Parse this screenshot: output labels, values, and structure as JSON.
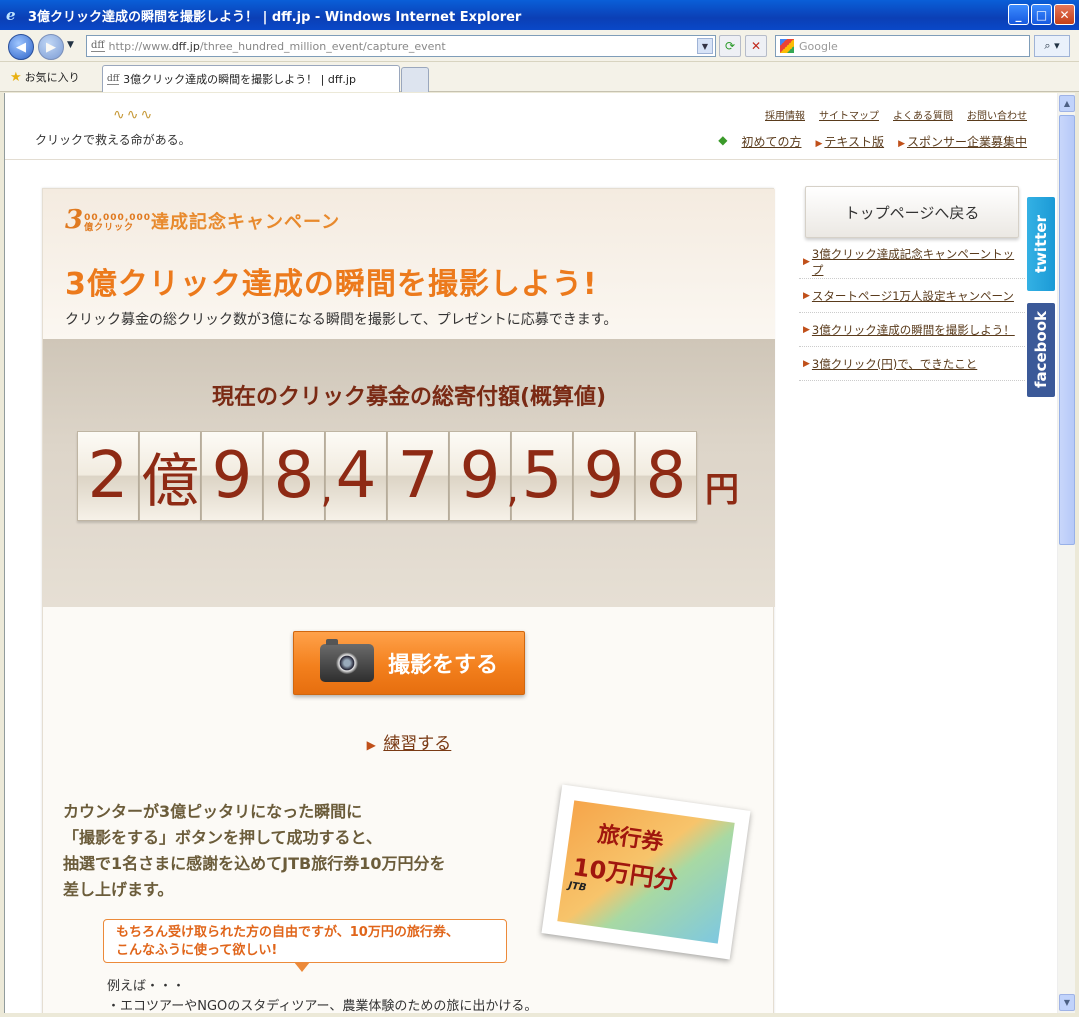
{
  "window": {
    "title": "3億クリック達成の瞬間を撮影しよう！ | dff.jp - Windows Internet Explorer",
    "minimize": "_",
    "maximize": "□",
    "close": "✕"
  },
  "address_bar": {
    "logo": "dff",
    "prefix": "http://www.",
    "host": "dff.jp",
    "path": "/three_hundred_million_event/capture_event"
  },
  "search": {
    "placeholder": "Google"
  },
  "favorites": {
    "label": "お気に入り"
  },
  "tab": {
    "logo": "dff",
    "title": "3億クリック達成の瞬間を撮影しよう！ | dff.jp"
  },
  "header": {
    "tagline": "クリックで救える命がある。",
    "top_links": [
      "採用情報",
      "サイトマップ",
      "よくある質問",
      "お問い合わせ"
    ],
    "sub_links": [
      "初めての方",
      "テキスト版",
      "スポンサー企業募集中"
    ]
  },
  "campaign": {
    "big3": "3",
    "small_top": "00,000,000",
    "small_bottom": "億クリック",
    "label": "達成記念キャンペーン"
  },
  "main": {
    "title": "3億クリック達成の瞬間を撮影しよう!",
    "subtitle": "クリック募金の総クリック数が3億になる瞬間を撮影して、プレゼントに応募できます。",
    "counter_label": "現在のクリック募金の総寄付額(概算値)",
    "digits": [
      "2",
      "億",
      "9",
      "8",
      "4",
      "7",
      "9",
      "5",
      "9",
      "8"
    ],
    "unit": "円",
    "shoot_button": "撮影をする",
    "practice_link": "練習する",
    "desc_lines": [
      "カウンターが3億ピッタリになった瞬間に",
      "「撮影をする」ボタンを押して成功すると、",
      "抽選で1名さまに感謝を込めてJTB旅行券10万円分を",
      "差し上げます。"
    ],
    "voucher": {
      "line1": "旅行券",
      "line2": "10万円分",
      "brand": "JTB"
    },
    "bubble_lines": [
      "もちろん受け取られた方の自由ですが、10万円の旅行券、",
      "こんなふうに使って欲しい!"
    ],
    "example_title": "例えば・・・",
    "example_item": "・エコツアーやNGOのスタディツアー、農業体験のための旅に出かける。"
  },
  "sidebar": {
    "back_button": "トップページへ戻る",
    "links": [
      "3億クリック達成記念キャンペーントップ",
      "スタートページ1万人設定キャンペーン",
      "3億クリック達成の瞬間を撮影しよう！",
      "3億クリック(円)で、できたこと"
    ],
    "twitter": "twitter",
    "facebook": "facebook"
  },
  "colors": {
    "accent": "#ec7a1c",
    "counter": "#8e2a14",
    "link": "#5a3b1c"
  }
}
